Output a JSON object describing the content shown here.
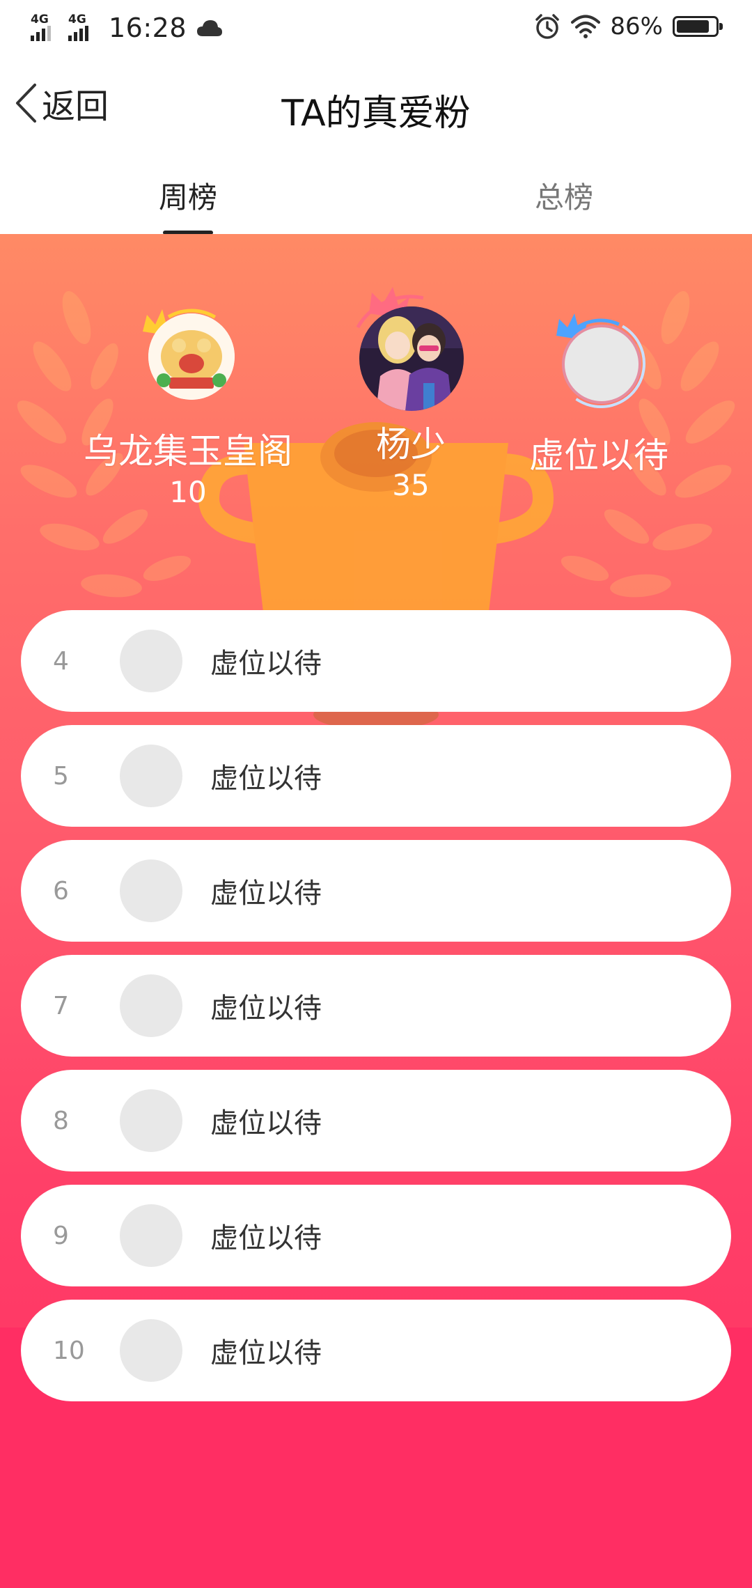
{
  "status_bar": {
    "network_1": "4G",
    "network_2": "4G",
    "time": "16:28",
    "battery_percent": "86%",
    "battery_level": 0.86,
    "icons": [
      "cloud-icon",
      "alarm-icon",
      "wifi-icon",
      "battery-icon"
    ]
  },
  "header": {
    "back_label": "返回",
    "title": "TA的真爱粉"
  },
  "tabs": [
    {
      "label": "周榜",
      "active": true
    },
    {
      "label": "总榜",
      "active": false
    }
  ],
  "podium": {
    "first": {
      "name": "杨少",
      "score": "35"
    },
    "second": {
      "name": "乌龙集玉皇阁",
      "score": "10"
    },
    "third": {
      "name": "虚位以待",
      "score": ""
    }
  },
  "ranking": [
    {
      "rank": "4",
      "name": "虚位以待"
    },
    {
      "rank": "5",
      "name": "虚位以待"
    },
    {
      "rank": "6",
      "name": "虚位以待"
    },
    {
      "rank": "7",
      "name": "虚位以待"
    },
    {
      "rank": "8",
      "name": "虚位以待"
    },
    {
      "rank": "9",
      "name": "虚位以待"
    },
    {
      "rank": "10",
      "name": "虚位以待"
    }
  ],
  "colors": {
    "gradient_top": "#ff8a65",
    "gradient_bottom": "#ff2e63",
    "crown_gold": "#ffcc33",
    "crown_pink": "#ff6b81",
    "crown_blue": "#4da3ff",
    "placeholder_gray": "#e8e8e8"
  }
}
